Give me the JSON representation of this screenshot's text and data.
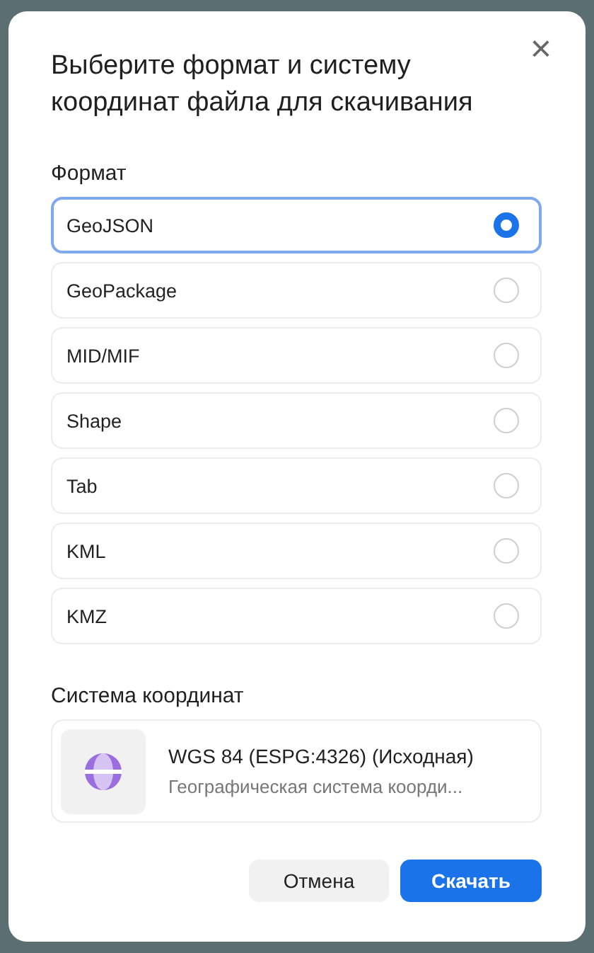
{
  "dialog": {
    "title": "Выберите формат и систему координат файла для скачивания",
    "close": "×"
  },
  "format": {
    "label": "Формат",
    "options": [
      {
        "label": "GeoJSON",
        "selected": true
      },
      {
        "label": "GeoPackage",
        "selected": false
      },
      {
        "label": "MID/MIF",
        "selected": false
      },
      {
        "label": "Shape",
        "selected": false
      },
      {
        "label": "Tab",
        "selected": false
      },
      {
        "label": "KML",
        "selected": false
      },
      {
        "label": "KMZ",
        "selected": false
      }
    ]
  },
  "crs": {
    "label": "Система координат",
    "name": "WGS 84 (ESPG:4326) (Исходная)",
    "description": "Географическая система коорди..."
  },
  "buttons": [
    {
      "label": "Отмена",
      "kind": "secondary"
    },
    {
      "label": "Скачать",
      "kind": "primary"
    }
  ]
}
